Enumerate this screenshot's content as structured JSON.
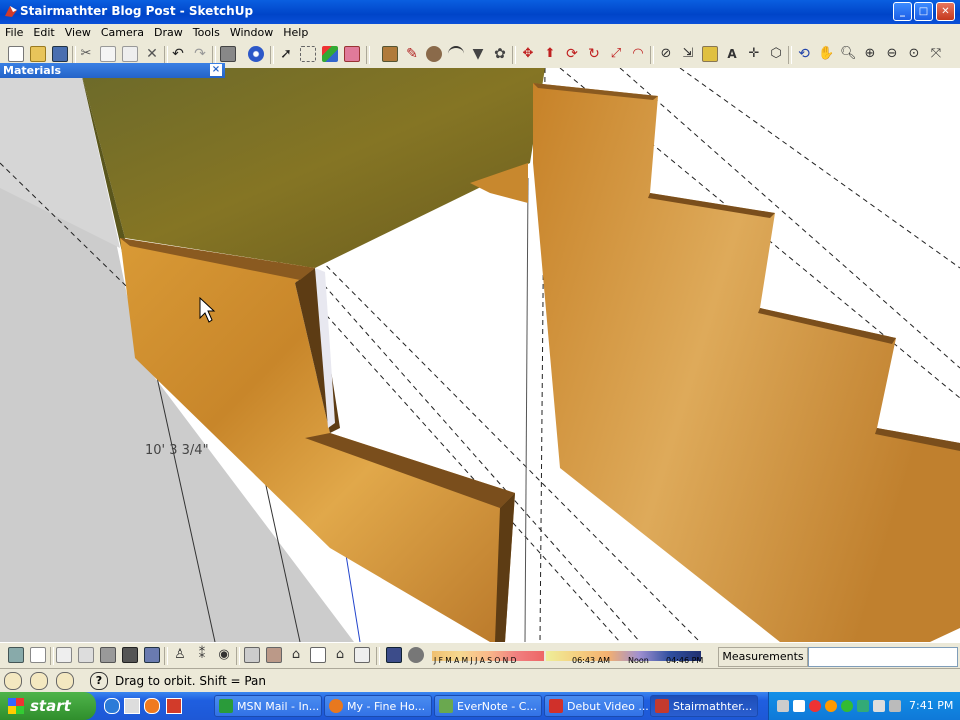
{
  "window": {
    "title": "Stairmathter Blog Post - SketchUp"
  },
  "menu": [
    "File",
    "Edit",
    "View",
    "Camera",
    "Draw",
    "Tools",
    "Window",
    "Help"
  ],
  "panel": {
    "title": "Materials",
    "close": "×"
  },
  "dimension": {
    "label": "10' 3 3/4\""
  },
  "shadow_bar": {
    "months": "J F M A M J J A S O N D",
    "time_start": "06:43 AM",
    "noon": "Noon",
    "time_end": "04:46 PM"
  },
  "measurements": {
    "label": "Measurements",
    "value": ""
  },
  "status": {
    "hint": "Drag to orbit.  Shift = Pan"
  },
  "taskbar": {
    "start": "start",
    "tasks": [
      {
        "label": "MSN Mail - In...",
        "color": "#2a9b3a"
      },
      {
        "label": "My - Fine Ho...",
        "color": "#e8781e"
      },
      {
        "label": "EverNote - C...",
        "color": "#6aa84f"
      },
      {
        "label": "Debut Video ...",
        "color": "#d0302a"
      },
      {
        "label": "Stairmathter...",
        "color": "#c43a2e",
        "active": true
      }
    ],
    "clock": "7:41 PM"
  },
  "colors": {
    "xp_blue": "#0044c8",
    "wood": "#d89a3a",
    "olive": "#7a6a22",
    "accent_green": "#2f8e2c"
  }
}
